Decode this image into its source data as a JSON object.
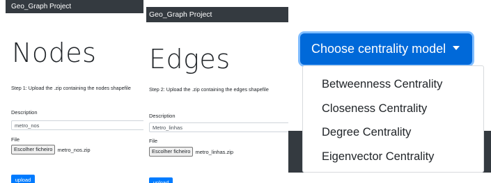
{
  "nodes_panel": {
    "navbar_title": "Geo_Graph Project",
    "heading": "Nodes",
    "step_text": "Step 1: Upload the .zip containing the nodes shapefile",
    "description_label": "Description",
    "description_value": "metro_nos",
    "file_label": "File",
    "file_button_label": "Escolher ficheiro",
    "file_name": "metro_nos.zip",
    "upload_label": "upload"
  },
  "edges_panel": {
    "navbar_title": "Geo_Graph Project",
    "heading": "Edges",
    "step_text": "Step 2: Upload the .zip containing the edges shapefile",
    "description_label": "Description",
    "description_value": "Metro_linhas",
    "file_label": "File",
    "file_button_label": "Escolher ficheiro",
    "file_name": "metro_linhas.zip",
    "upload_label": "upload"
  },
  "centrality": {
    "button_label": "Choose centrality model",
    "options": [
      "Betweenness Centrality",
      "Closeness Centrality",
      "Degree Centrality",
      "Eigenvector Centrality"
    ]
  },
  "colors": {
    "primary": "#007bff",
    "navbar": "#343a40"
  }
}
